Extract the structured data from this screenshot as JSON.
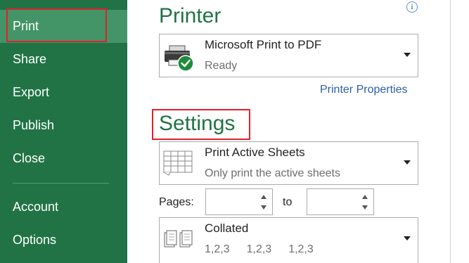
{
  "sidebar": {
    "items": [
      {
        "label": "Print"
      },
      {
        "label": "Share"
      },
      {
        "label": "Export"
      },
      {
        "label": "Publish"
      },
      {
        "label": "Close"
      },
      {
        "label": "Account"
      },
      {
        "label": "Options"
      }
    ]
  },
  "printer": {
    "heading": "Printer",
    "name": "Microsoft Print to PDF",
    "status": "Ready",
    "properties_link": "Printer Properties"
  },
  "settings": {
    "heading": "Settings",
    "scope_title": "Print Active Sheets",
    "scope_sub": "Only print the active sheets",
    "pages_label": "Pages:",
    "to_label": "to",
    "pages_from": "",
    "pages_to": "",
    "collate_title": "Collated",
    "collate_values": [
      "1,2,3",
      "1,2,3",
      "1,2,3"
    ]
  },
  "colors": {
    "sidebar": "#217346",
    "selected": "#439467",
    "accent": "#217346",
    "highlight_box": "#e0202a",
    "link": "#2b5ea8"
  },
  "icons": [
    "printer-icon",
    "checkmark-icon",
    "info-icon",
    "sheet-grid-icon",
    "collate-icon",
    "dropdown-arrow-icon",
    "spin-up-icon",
    "spin-down-icon"
  ]
}
